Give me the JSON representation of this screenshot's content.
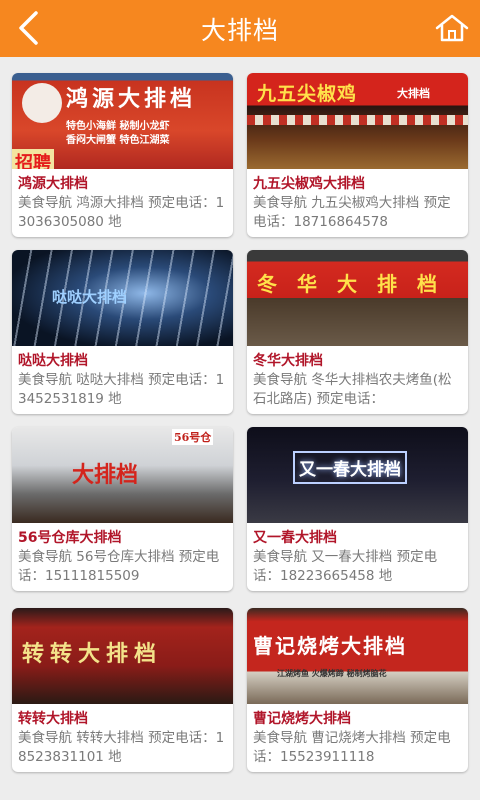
{
  "header": {
    "title": "大排档",
    "back_icon": "back-arrow-icon",
    "home_icon": "home-icon"
  },
  "colors": {
    "accent": "#f6871f",
    "name": "#b1162a",
    "desc": "#7a7a7a",
    "background": "#ededed"
  },
  "cards": [
    {
      "name": "鸿源大排档",
      "desc": "美食导航 鸿源大排档 预定电话：13036305080 地",
      "sign": "鸿源大排档",
      "sign_sub1": "特色小海鲜  秘制小龙虾",
      "sign_sub2": "香闷大闸蟹  特色江湖菜",
      "sign_extra": "招聘"
    },
    {
      "name": "九五尖椒鸡大排档",
      "desc": "美食导航 九五尖椒鸡大排档 预定电话：18716864578",
      "sign": "九五尖椒鸡",
      "sign_sub1": "大排档"
    },
    {
      "name": "哒哒大排档",
      "desc": "美食导航 哒哒大排档 预定电话：13452531819 地",
      "sign": "哒哒大排档"
    },
    {
      "name": "冬华大排档",
      "desc": "美食导航 冬华大排档农夫烤鱼(松石北路店) 预定电话：",
      "sign": "冬华大排档"
    },
    {
      "name": "56号仓库大排档",
      "desc": "美食导航 56号仓库大排档 预定电话：15111815509",
      "sign": "大排档",
      "sign_sub1": "56号仓"
    },
    {
      "name": "又一春大排档",
      "desc": "美食导航 又一春大排档 预定电话：18223665458 地",
      "sign": "又一春大排档"
    },
    {
      "name": "转转大排档",
      "desc": "美食导航 转转大排档 预定电话：18523831101 地",
      "sign": "转转大排档"
    },
    {
      "name": "曹记烧烤大排档",
      "desc": "美食导航 曹记烧烤大排档 预定电话：15523911118",
      "sign": "曹记烧烤大排档",
      "sign_sub1": "江湖烤鱼  火爆烤蹄  秘制烤脑花"
    }
  ]
}
